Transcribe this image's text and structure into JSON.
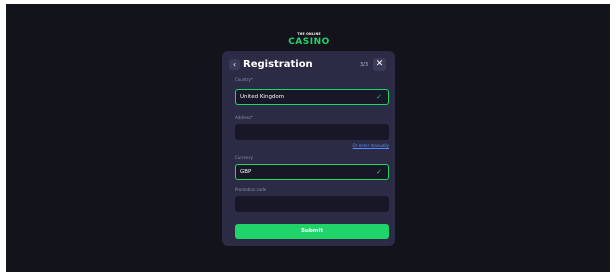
{
  "logo": {
    "line1": "THE ONLINE",
    "line2": "CASINO",
    "accent_color": "#20d46a"
  },
  "modal": {
    "title": "Registration",
    "step": "3/3",
    "back_icon": "chevron-left-icon",
    "close_icon": "close-icon"
  },
  "form": {
    "country": {
      "label": "Country*",
      "value": "United Kingdom",
      "valid": true
    },
    "address": {
      "label": "Address*",
      "value": "",
      "alt_link": "Or enter manually"
    },
    "currency": {
      "label": "Currency",
      "value": "GBP",
      "valid": true
    },
    "promo": {
      "label": "Promotion code",
      "value": ""
    },
    "submit_label": "Submit"
  },
  "colors": {
    "background": "#13131b",
    "modal": "#2b2b45",
    "input": "#171727",
    "accent": "#20d46a",
    "link": "#5b8cff"
  }
}
